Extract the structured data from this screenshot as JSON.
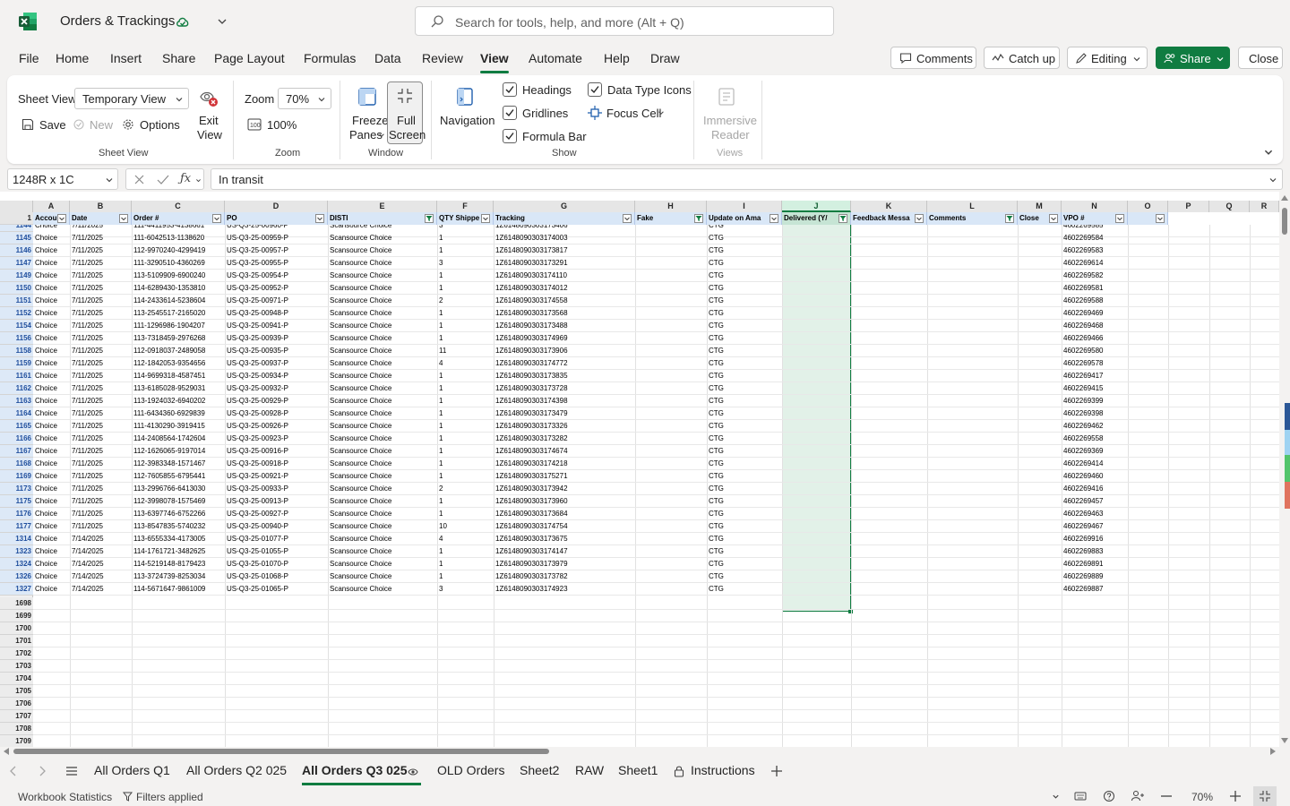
{
  "app": {
    "document_title": "Orders & Trackings",
    "search_placeholder": "Search for tools, help, and more (Alt + Q)"
  },
  "menu": {
    "items": [
      "File",
      "Home",
      "Insert",
      "Share",
      "Page Layout",
      "Formulas",
      "Data",
      "Review",
      "View",
      "Automate",
      "Help",
      "Draw"
    ],
    "active": "View",
    "comments_label": "Comments",
    "catchup_label": "Catch up",
    "editing_label": "Editing",
    "share_label": "Share",
    "close_label": "Close"
  },
  "ribbon": {
    "sheet_view_label": "Sheet View",
    "sheet_view_value": "Temporary View",
    "exit_view_label_1": "Exit",
    "exit_view_label_2": "View",
    "save_label": "Save",
    "new_label": "New",
    "options_label": "Options",
    "group_sheet_view": "Sheet View",
    "zoom_label": "Zoom",
    "zoom_value": "70%",
    "zoom_100_label": "100%",
    "group_zoom": "Zoom",
    "freeze_label_1": "Freeze",
    "freeze_label_2": "Panes",
    "fullscreen_label_1": "Full",
    "fullscreen_label_2": "Screen",
    "group_window": "Window",
    "navigation_label": "Navigation",
    "headings_label": "Headings",
    "gridlines_label": "Gridlines",
    "formula_bar_label": "Formula Bar",
    "data_type_icons_label": "Data Type Icons",
    "focus_cell_label": "Focus Cell",
    "group_show": "Show",
    "immersive_label_1": "Immersive",
    "immersive_label_2": "Reader",
    "group_views": "Views"
  },
  "formula_bar": {
    "name_box": "1248R x 1C",
    "formula": "In transit"
  },
  "grid": {
    "columns": [
      "A",
      "B",
      "C",
      "D",
      "E",
      "F",
      "G",
      "H",
      "I",
      "J",
      "K",
      "L",
      "M",
      "N",
      "O",
      "P",
      "Q",
      "R"
    ],
    "selected_column": "J",
    "header_row_number": "1",
    "headers": [
      "Accou",
      "Date",
      "Order #",
      "PO",
      "DISTI",
      "QTY Shippe",
      "Tracking",
      "Fake",
      "Update on Ama",
      "Delivered (Y/",
      "Feedback Messa",
      "Comments",
      "Close",
      "VPO #",
      "",
      "",
      "",
      ""
    ],
    "partial_row": {
      "row": "1144",
      "a": "Choice",
      "b": "7/11/2025",
      "c": "111-4411953-4138661",
      "d": "US-Q3-25-00960-P",
      "e": "Scansource Choice",
      "f": "3",
      "g": "1Z6148090303173406",
      "i": "CTG",
      "n": "4602269585"
    },
    "rows": [
      {
        "row": "1145",
        "a": "Choice",
        "b": "7/11/2025",
        "c": "111-6042513-1138620",
        "d": "US-Q3-25-00959-P",
        "e": "Scansource Choice",
        "f": "1",
        "g": "1Z6148090303174003",
        "i": "CTG",
        "n": "4602269584"
      },
      {
        "row": "1146",
        "a": "Choice",
        "b": "7/11/2025",
        "c": "112-9970240-4299419",
        "d": "US-Q3-25-00957-P",
        "e": "Scansource Choice",
        "f": "1",
        "g": "1Z6148090303173817",
        "i": "CTG",
        "n": "4602269583"
      },
      {
        "row": "1147",
        "a": "Choice",
        "b": "7/11/2025",
        "c": "111-3290510-4360269",
        "d": "US-Q3-25-00955-P",
        "e": "Scansource Choice",
        "f": "3",
        "g": "1Z6148090303173291",
        "i": "CTG",
        "n": "4602269614"
      },
      {
        "row": "1149",
        "a": "Choice",
        "b": "7/11/2025",
        "c": "113-5109909-6900240",
        "d": "US-Q3-25-00954-P",
        "e": "Scansource Choice",
        "f": "1",
        "g": "1Z6148090303174110",
        "i": "CTG",
        "n": "4602269582"
      },
      {
        "row": "1150",
        "a": "Choice",
        "b": "7/11/2025",
        "c": "114-6289430-1353810",
        "d": "US-Q3-25-00952-P",
        "e": "Scansource Choice",
        "f": "1",
        "g": "1Z6148090303174012",
        "i": "CTG",
        "n": "4602269581"
      },
      {
        "row": "1151",
        "a": "Choice",
        "b": "7/11/2025",
        "c": "114-2433614-5238604",
        "d": "US-Q3-25-00971-P",
        "e": "Scansource Choice",
        "f": "2",
        "g": "1Z6148090303174558",
        "i": "CTG",
        "n": "4602269588"
      },
      {
        "row": "1152",
        "a": "Choice",
        "b": "7/11/2025",
        "c": "113-2545517-2165020",
        "d": "US-Q3-25-00948-P",
        "e": "Scansource Choice",
        "f": "1",
        "g": "1Z6148090303173568",
        "i": "CTG",
        "n": "4602269469"
      },
      {
        "row": "1154",
        "a": "Choice",
        "b": "7/11/2025",
        "c": "111-1296986-1904207",
        "d": "US-Q3-25-00941-P",
        "e": "Scansource Choice",
        "f": "1",
        "g": "1Z6148090303173488",
        "i": "CTG",
        "n": "4602269468"
      },
      {
        "row": "1156",
        "a": "Choice",
        "b": "7/11/2025",
        "c": "113-7318459-2976268",
        "d": "US-Q3-25-00939-P",
        "e": "Scansource Choice",
        "f": "1",
        "g": "1Z6148090303174969",
        "i": "CTG",
        "n": "4602269466"
      },
      {
        "row": "1158",
        "a": "Choice",
        "b": "7/11/2025",
        "c": "112-0918037-2489058",
        "d": "US-Q3-25-00935-P",
        "e": "Scansource Choice",
        "f": "11",
        "g": "1Z6148090303173906",
        "i": "CTG",
        "n": "4602269580"
      },
      {
        "row": "1159",
        "a": "Choice",
        "b": "7/11/2025",
        "c": "112-1842053-9354656",
        "d": "US-Q3-25-00937-P",
        "e": "Scansource Choice",
        "f": "4",
        "g": "1Z6148090303174772",
        "i": "CTG",
        "n": "4602269578"
      },
      {
        "row": "1161",
        "a": "Choice",
        "b": "7/11/2025",
        "c": "114-9699318-4587451",
        "d": "US-Q3-25-00934-P",
        "e": "Scansource Choice",
        "f": "1",
        "g": "1Z6148090303173835",
        "i": "CTG",
        "n": "4602269417"
      },
      {
        "row": "1162",
        "a": "Choice",
        "b": "7/11/2025",
        "c": "113-6185028-9529031",
        "d": "US-Q3-25-00932-P",
        "e": "Scansource Choice",
        "f": "1",
        "g": "1Z6148090303173728",
        "i": "CTG",
        "n": "4602269415"
      },
      {
        "row": "1163",
        "a": "Choice",
        "b": "7/11/2025",
        "c": "113-1924032-6940202",
        "d": "US-Q3-25-00929-P",
        "e": "Scansource Choice",
        "f": "1",
        "g": "1Z6148090303174398",
        "i": "CTG",
        "n": "4602269399"
      },
      {
        "row": "1164",
        "a": "Choice",
        "b": "7/11/2025",
        "c": "111-6434360-6929839",
        "d": "US-Q3-25-00928-P",
        "e": "Scansource Choice",
        "f": "1",
        "g": "1Z6148090303173479",
        "i": "CTG",
        "n": "4602269398"
      },
      {
        "row": "1165",
        "a": "Choice",
        "b": "7/11/2025",
        "c": "111-4130290-3919415",
        "d": "US-Q3-25-00926-P",
        "e": "Scansource Choice",
        "f": "1",
        "g": "1Z6148090303173326",
        "i": "CTG",
        "n": "4602269462"
      },
      {
        "row": "1166",
        "a": "Choice",
        "b": "7/11/2025",
        "c": "114-2408564-1742604",
        "d": "US-Q3-25-00923-P",
        "e": "Scansource Choice",
        "f": "1",
        "g": "1Z6148090303173282",
        "i": "CTG",
        "n": "4602269558"
      },
      {
        "row": "1167",
        "a": "Choice",
        "b": "7/11/2025",
        "c": "112-1626065-9197014",
        "d": "US-Q3-25-00916-P",
        "e": "Scansource Choice",
        "f": "1",
        "g": "1Z6148090303174674",
        "i": "CTG",
        "n": "4602269369"
      },
      {
        "row": "1168",
        "a": "Choice",
        "b": "7/11/2025",
        "c": "112-3983348-1571467",
        "d": "US-Q3-25-00918-P",
        "e": "Scansource Choice",
        "f": "1",
        "g": "1Z6148090303174218",
        "i": "CTG",
        "n": "4602269414"
      },
      {
        "row": "1169",
        "a": "Choice",
        "b": "7/11/2025",
        "c": "112-7605855-6795441",
        "d": "US-Q3-25-00921-P",
        "e": "Scansource Choice",
        "f": "1",
        "g": "1Z6148090303175271",
        "i": "CTG",
        "n": "4602269460"
      },
      {
        "row": "1173",
        "a": "Choice",
        "b": "7/11/2025",
        "c": "113-2996766-6413030",
        "d": "US-Q3-25-00933-P",
        "e": "Scansource Choice",
        "f": "2",
        "g": "1Z6148090303173942",
        "i": "CTG",
        "n": "4602269416"
      },
      {
        "row": "1175",
        "a": "Choice",
        "b": "7/11/2025",
        "c": "112-3998078-1575469",
        "d": "US-Q3-25-00913-P",
        "e": "Scansource Choice",
        "f": "1",
        "g": "1Z6148090303173960",
        "i": "CTG",
        "n": "4602269457"
      },
      {
        "row": "1176",
        "a": "Choice",
        "b": "7/11/2025",
        "c": "113-6397746-6752266",
        "d": "US-Q3-25-00927-P",
        "e": "Scansource Choice",
        "f": "1",
        "g": "1Z6148090303173684",
        "i": "CTG",
        "n": "4602269463"
      },
      {
        "row": "1177",
        "a": "Choice",
        "b": "7/11/2025",
        "c": "113-8547835-5740232",
        "d": "US-Q3-25-00940-P",
        "e": "Scansource Choice",
        "f": "10",
        "g": "1Z6148090303174754",
        "i": "CTG",
        "n": "4602269467"
      },
      {
        "row": "1314",
        "a": "Choice",
        "b": "7/14/2025",
        "c": "113-6555334-4173005",
        "d": "US-Q3-25-01077-P",
        "e": "Scansource Choice",
        "f": "4",
        "g": "1Z6148090303173675",
        "i": "CTG",
        "n": "4602269916"
      },
      {
        "row": "1323",
        "a": "Choice",
        "b": "7/14/2025",
        "c": "114-1761721-3482625",
        "d": "US-Q3-25-01055-P",
        "e": "Scansource Choice",
        "f": "1",
        "g": "1Z6148090303174147",
        "i": "CTG",
        "n": "4602269883"
      },
      {
        "row": "1324",
        "a": "Choice",
        "b": "7/14/2025",
        "c": "114-5219148-8179423",
        "d": "US-Q3-25-01070-P",
        "e": "Scansource Choice",
        "f": "1",
        "g": "1Z6148090303173979",
        "i": "CTG",
        "n": "4602269891"
      },
      {
        "row": "1326",
        "a": "Choice",
        "b": "7/14/2025",
        "c": "113-3724739-8253034",
        "d": "US-Q3-25-01068-P",
        "e": "Scansource Choice",
        "f": "1",
        "g": "1Z6148090303173782",
        "i": "CTG",
        "n": "4602269889"
      },
      {
        "row": "1327",
        "a": "Choice",
        "b": "7/14/2025",
        "c": "114-5671647-9861009",
        "d": "US-Q3-25-01065-P",
        "e": "Scansource Choice",
        "f": "3",
        "g": "1Z6148090303174923",
        "i": "CTG",
        "n": "4602269887"
      }
    ],
    "empty_rows": [
      "1698",
      "1699",
      "1700",
      "1701",
      "1702",
      "1703",
      "1704",
      "1705",
      "1706",
      "1707",
      "1708",
      "1709"
    ]
  },
  "sheet_tabs": {
    "tabs": [
      "All Orders Q1",
      "All Orders Q2 025",
      "All Orders Q3 025",
      "OLD Orders",
      "Sheet2",
      "RAW",
      "Sheet1",
      "Instructions"
    ],
    "active": "All Orders Q3 025"
  },
  "status": {
    "workbook_statistics": "Workbook Statistics",
    "filters_applied": "Filters applied",
    "zoom": "70%"
  },
  "colors": {
    "brand_green": "#107c41",
    "selected_column_fill": "#e2f1e8",
    "table_header_fill": "#d9e7f7"
  }
}
